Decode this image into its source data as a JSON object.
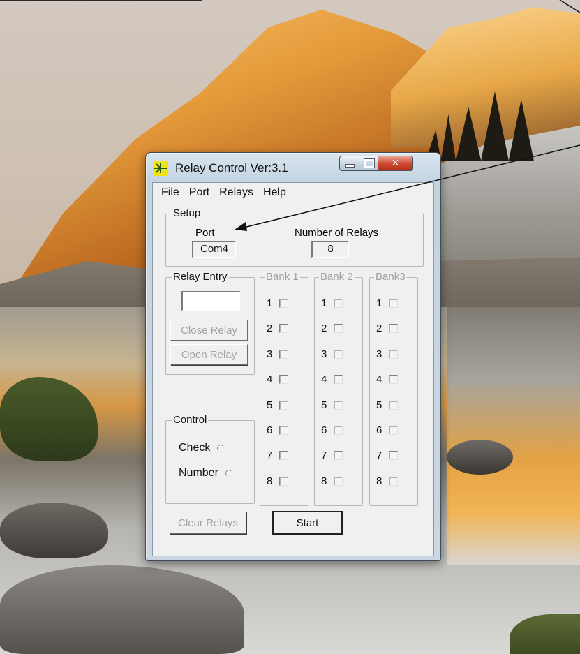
{
  "window": {
    "title": "Relay Control Ver:3.1",
    "icon": "relay-app-icon"
  },
  "menu": [
    "File",
    "Port",
    "Relays",
    "Help"
  ],
  "setup": {
    "group_label": "Setup",
    "port_label": "Port",
    "port_value": "Com4",
    "relays_label": "Number of Relays",
    "relays_value": "8"
  },
  "relay_entry": {
    "group_label": "Relay Entry",
    "input_value": "",
    "close_button": "Close Relay",
    "open_button": "Open Relay"
  },
  "banks": [
    {
      "label": "Bank 1",
      "relays": [
        "1",
        "2",
        "3",
        "4",
        "5",
        "6",
        "7",
        "8"
      ]
    },
    {
      "label": "Bank 2",
      "relays": [
        "1",
        "2",
        "3",
        "4",
        "5",
        "6",
        "7",
        "8"
      ]
    },
    {
      "label": "Bank3",
      "relays": [
        "1",
        "2",
        "3",
        "4",
        "5",
        "6",
        "7",
        "8"
      ]
    }
  ],
  "control": {
    "group_label": "Control",
    "check_label": "Check",
    "number_label": "Number"
  },
  "buttons": {
    "clear_relays": "Clear Relays",
    "start": "Start"
  },
  "colors": {
    "close_button": "#c7402a",
    "disabled_text": "#a3a3a3",
    "client_background": "#f0f0f0"
  }
}
